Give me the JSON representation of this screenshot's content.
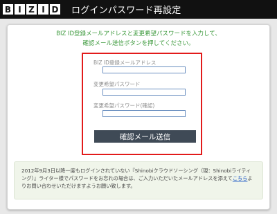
{
  "header": {
    "logo_letters": [
      "B",
      "I",
      "Z",
      "I",
      "D"
    ],
    "title": "ログインパスワード再設定"
  },
  "intro": {
    "line1": "BIZ ID登録メールアドレスと変更希望パスワードを入力して、",
    "line2": "確認メール送信ボタンを押してください。"
  },
  "form": {
    "email_label": "BIZ ID登録メールアドレス",
    "email_value": "",
    "password_label": "変更希望パスワード",
    "password_value": "",
    "password_confirm_label": "変更希望パスワード(確認)",
    "password_confirm_value": "",
    "submit_label": "確認メール送信"
  },
  "notice": {
    "text_before_link": "2012年9月3日以降一度もログインされていない『Shinobiクラウドソーシング（現：Shinobiライティング）』ライター様でパスワードをお忘れの場合は、ご入力いただいたメールアドレスを添えて",
    "link_label": "こちら",
    "text_after_link": "よりお問い合わせいただけますようお願い致します。"
  },
  "colors": {
    "header_bg": "#111111",
    "intro_green": "#3d9a3d",
    "highlight_red": "#e21b1b",
    "button_bg": "#3f4a56",
    "notice_bg": "#f0f5ea",
    "link_blue": "#1a55c4"
  }
}
